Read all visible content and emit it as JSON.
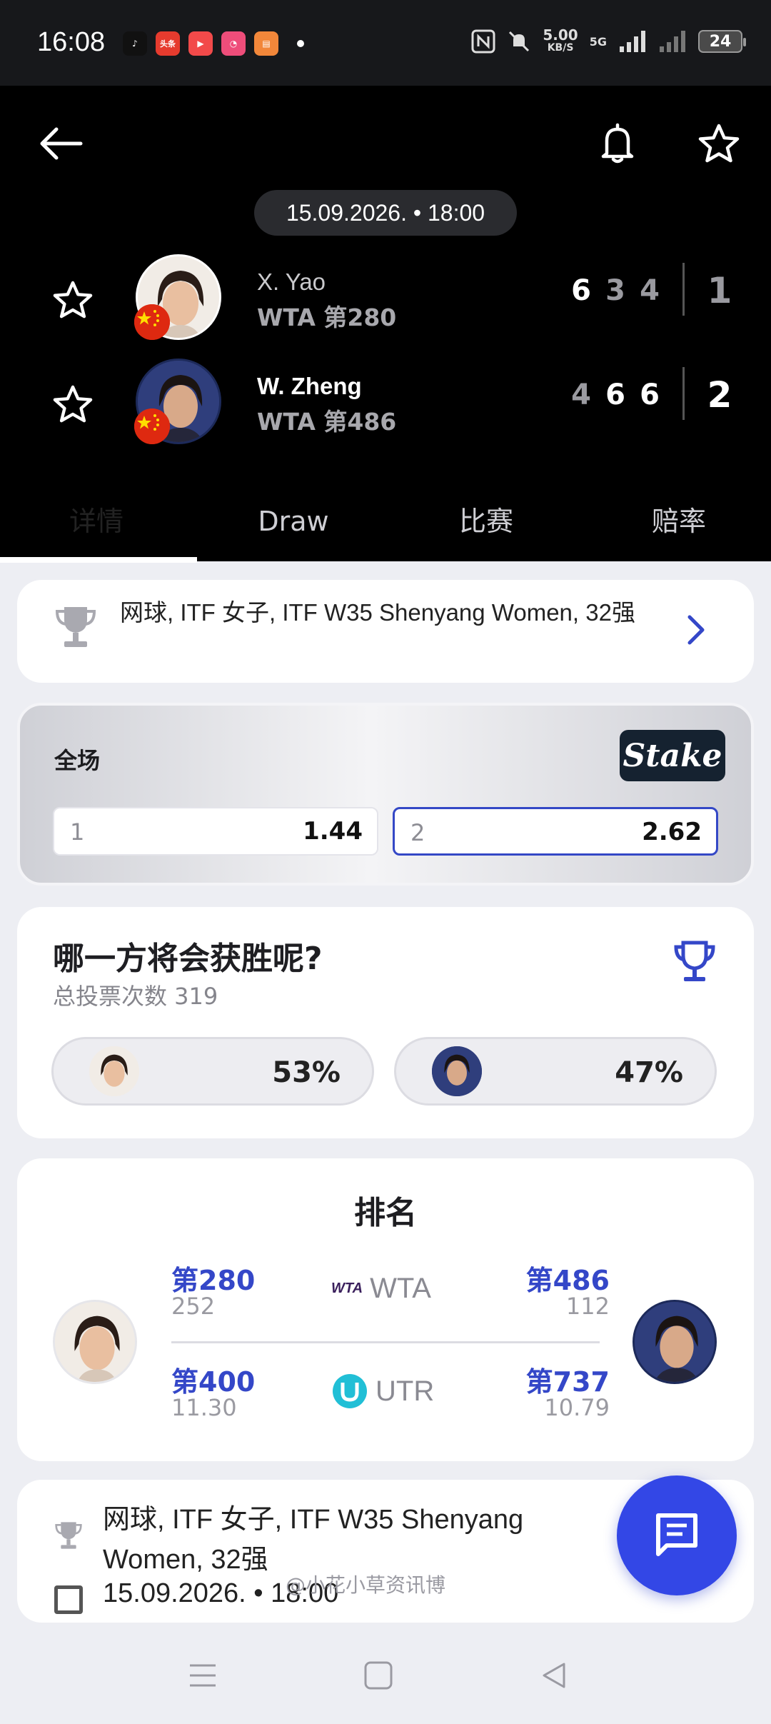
{
  "status_bar": {
    "time": "16:08",
    "net_speed": "5.00",
    "net_unit": "KB/S",
    "signal_label": "5G",
    "battery": "24",
    "apps": [
      {
        "name": "tiktok-app-icon",
        "color": "#111111",
        "label": "♪"
      },
      {
        "name": "toutiao-app-icon",
        "color": "#e63b2e",
        "label": "头条"
      },
      {
        "name": "video-app-icon",
        "color": "#f24a4a",
        "label": "▶"
      },
      {
        "name": "chat-app-icon",
        "color": "#ee4d7a",
        "label": "◔"
      },
      {
        "name": "reader-app-icon",
        "color": "#f2873a",
        "label": "▤"
      }
    ]
  },
  "match": {
    "datetime": "15.09.2026. • 18:00",
    "players": [
      {
        "name": "X. Yao",
        "rank": "WTA 第280",
        "sets": [
          "6",
          "3",
          "4"
        ],
        "sets_won": [
          true,
          false,
          false
        ],
        "total": "1"
      },
      {
        "name": "W. Zheng",
        "rank": "WTA 第486",
        "sets": [
          "4",
          "6",
          "6"
        ],
        "sets_won": [
          false,
          true,
          true
        ],
        "total": "2"
      }
    ]
  },
  "tabs": [
    {
      "label": "详情"
    },
    {
      "label": "Draw"
    },
    {
      "label": "比赛"
    },
    {
      "label": "赔率"
    }
  ],
  "tournament": {
    "text": "网球, ITF 女子, ITF W35 Shenyang Women, 32强"
  },
  "odds": {
    "label": "全场",
    "bookmaker": "Stake",
    "options": [
      {
        "key": "1",
        "value": "1.44"
      },
      {
        "key": "2",
        "value": "2.62"
      }
    ]
  },
  "vote": {
    "question": "哪一方将会获胜呢?",
    "total_votes": "总投票次数 319",
    "results": [
      {
        "pct": "53%",
        "value": 53
      },
      {
        "pct": "47%",
        "value": 47
      }
    ]
  },
  "ranking": {
    "title": "排名",
    "rows": [
      {
        "org": "WTA",
        "org_mark": "WTA",
        "left_rank": "第280",
        "left_points": "252",
        "right_rank": "第486",
        "right_points": "112"
      },
      {
        "org": "UTR",
        "left_rank": "第400",
        "left_points": "11.30",
        "right_rank": "第737",
        "right_points": "10.79"
      }
    ]
  },
  "info": {
    "tournament_text": "网球, ITF 女子, ITF W35 Shenyang Women, 32强",
    "date_text": "15.09.2026. • 18:00"
  },
  "watermark": "@小花小草资讯博",
  "colors": {
    "accent": "#3447c8",
    "fab": "#3347e6",
    "header_bg": "#000000",
    "flag_red": "#de2910"
  }
}
